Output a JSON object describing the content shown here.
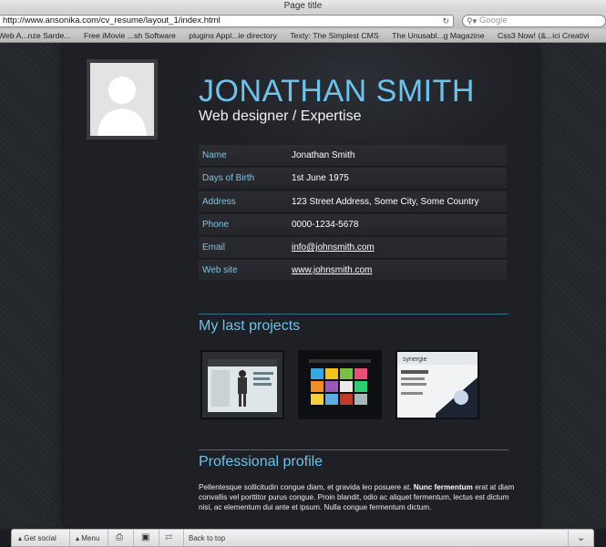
{
  "browser": {
    "title": "Page title",
    "url": "http://www.ansonika.com/cv_resume/layout_1/index.html",
    "search_placeholder": "Google",
    "bookmarks": [
      "Web A...nze Sarde...",
      "Free iMovie ...sh Software",
      "plugins Appl...ie directory",
      "Texty: The Simplest CMS",
      "The Unusabl...g Magazine",
      "Css3 Now! (&...ici Creativi"
    ]
  },
  "profile": {
    "name": "JONATHAN SMITH",
    "title": "Web designer / Expertise",
    "details": [
      {
        "label": "Name",
        "value": "Jonathan Smith"
      },
      {
        "label": "Days of Birth",
        "value": "1st June 1975"
      },
      {
        "label": "Address",
        "value": "123 Street Address, Some City, Some Country"
      },
      {
        "label": "Phone",
        "value": "0000-1234-5678"
      },
      {
        "label": "Email",
        "value": "info@johnsmith.com"
      },
      {
        "label": "Web site",
        "value": "www.johnsmith.com"
      }
    ]
  },
  "projects": {
    "heading": "My last projects",
    "thumb3_caption": "synergie"
  },
  "profile_section": {
    "heading": "Professional profile",
    "text_before": "Pellentesque sollicitudin congue diam, et gravida leo posuere at. ",
    "text_bold": "Nunc fermentum",
    "text_after": " erat at diam convallis vel porttitor purus congue. Proin blandit, odio ac aliquet fermentum, lectus est dictum nisi, ac elementum dui ante et ipsum. Nulla congue fermentum dictum."
  },
  "bottombar": {
    "get_social": "Get social",
    "menu": "Menu",
    "back_to_top": "Back to top"
  },
  "colors": {
    "accent": "#6cc3ec",
    "background": "#1e2025"
  }
}
